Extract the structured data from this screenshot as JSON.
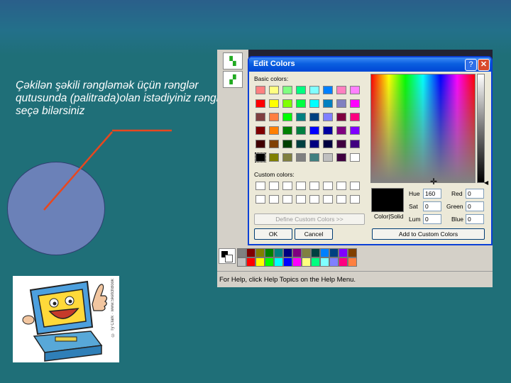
{
  "slide": {
    "caption": "Çəkilən şəkili rəngləmək üçün rənglər qutusunda (palitrada)olan istədiyiniz rəngi seçə bilərsiniz"
  },
  "clipart": {
    "credit": "© Ty Clark · www.SketchBook"
  },
  "paint": {
    "status_text": "For Help, click Help Topics on the Help Menu."
  },
  "dialog": {
    "title": "Edit Colors",
    "basic_colors_label": "Basic colors:",
    "custom_colors_label": "Custom colors:",
    "define_button": "Define Custom Colors >>",
    "ok_button": "OK",
    "cancel_button": "Cancel",
    "add_button": "Add to Custom Colors",
    "color_solid_label": "Color|Solid",
    "fields": {
      "hue_label": "Hue",
      "hue": "160",
      "sat_label": "Sat",
      "sat": "0",
      "lum_label": "Lum",
      "lum": "0",
      "red_label": "Red",
      "red": "0",
      "green_label": "Green",
      "green": "0",
      "blue_label": "Blue",
      "blue": "0"
    },
    "basic_colors": [
      [
        "#ff8080",
        "#ffff80",
        "#80ff80",
        "#00ff80",
        "#80ffff",
        "#0080ff",
        "#ff80c0",
        "#ff80ff"
      ],
      [
        "#ff0000",
        "#ffff00",
        "#80ff00",
        "#00ff40",
        "#00ffff",
        "#0080c0",
        "#8080c0",
        "#ff00ff"
      ],
      [
        "#804040",
        "#ff8040",
        "#00ff00",
        "#008080",
        "#004080",
        "#8080ff",
        "#800040",
        "#ff0080"
      ],
      [
        "#800000",
        "#ff8000",
        "#008000",
        "#008040",
        "#0000ff",
        "#0000a0",
        "#800080",
        "#8000ff"
      ],
      [
        "#400000",
        "#804000",
        "#004000",
        "#004040",
        "#000080",
        "#000040",
        "#400040",
        "#400080"
      ],
      [
        "#000000",
        "#808000",
        "#808040",
        "#808080",
        "#408080",
        "#c0c0c0",
        "#400040",
        "#ffffff"
      ]
    ]
  },
  "palette": [
    "#808080",
    "#800000",
    "#808000",
    "#008000",
    "#008080",
    "#000080",
    "#800080",
    "#808040",
    "#004040",
    "#0080ff",
    "#004080",
    "#8000ff",
    "#804000",
    "#c0c0c0",
    "#ff0000",
    "#ffff00",
    "#00ff00",
    "#00ffff",
    "#0000ff",
    "#ff00ff",
    "#ffff80",
    "#00ff80",
    "#80ffff",
    "#8080ff",
    "#ff0080",
    "#ff8040"
  ]
}
